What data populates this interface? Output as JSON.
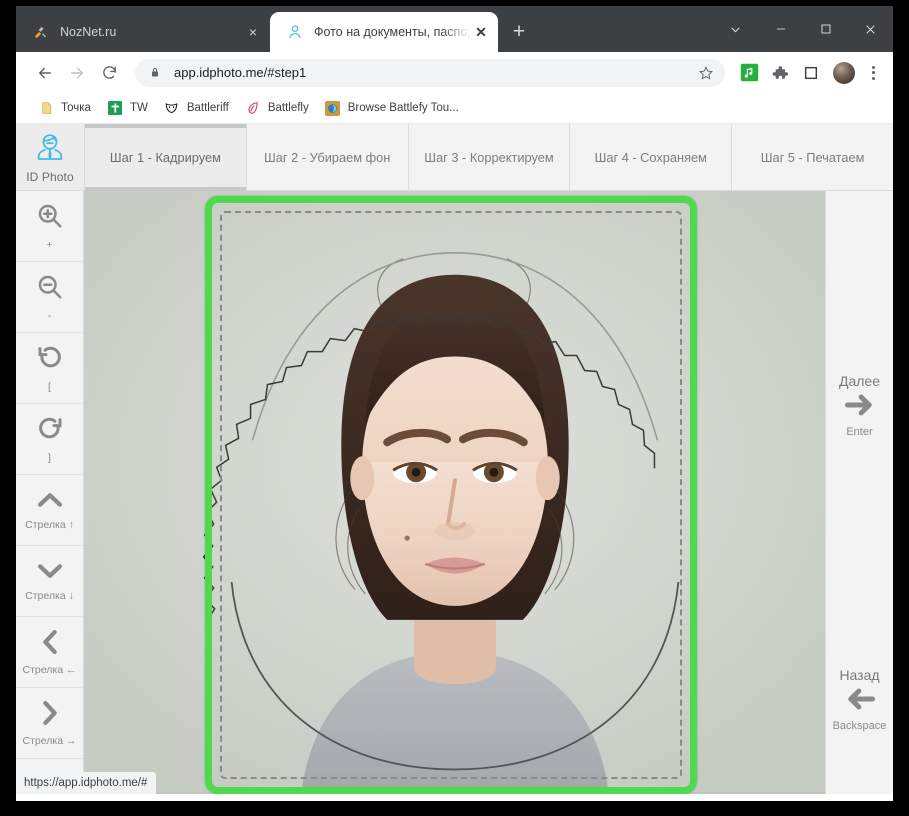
{
  "browser": {
    "tabs": [
      {
        "title": "NozNet.ru",
        "favicon": "tools-icon",
        "active": false,
        "close_label": "×"
      },
      {
        "title": "Фото на документы, паспорта, в",
        "favicon": "id-photo-icon",
        "active": true,
        "close_label": "✕"
      }
    ],
    "new_tab_label": "+",
    "window_controls": {
      "tab_search": "⌄",
      "minimize": "—",
      "maximize": "□",
      "close": "✕"
    },
    "toolbar": {
      "back": "←",
      "forward": "→",
      "reload": "⟳",
      "url": "app.idphoto.me/#step1",
      "lock": "lock-icon",
      "star": "☆",
      "extension_music": "♫",
      "extension_puzzle": "puzzle-icon",
      "extension_panel": "□",
      "profile": "avatar",
      "menu": "⋮"
    },
    "bookmarks": [
      {
        "label": "Точка",
        "icon": "note-icon"
      },
      {
        "label": "TW",
        "icon": "tw-icon"
      },
      {
        "label": "Battleriff",
        "icon": "battleriff-icon"
      },
      {
        "label": "Battlefly",
        "icon": "battlefly-icon"
      },
      {
        "label": "Browse Battlefy Tou...",
        "icon": "battlefy-icon"
      }
    ],
    "status_url": "https://app.idphoto.me/#"
  },
  "app": {
    "brand": {
      "label": "ID Photo",
      "icon": "id-photo-avatar-icon"
    },
    "steps": [
      {
        "label": "Шаг 1 - Кадрируем",
        "active": true
      },
      {
        "label": "Шаг 2 - Убираем фон",
        "active": false
      },
      {
        "label": "Шаг 3 - Корректируем",
        "active": false
      },
      {
        "label": "Шаг 4 - Сохраняем",
        "active": false
      },
      {
        "label": "Шаг 5 - Печатаем",
        "active": false
      }
    ],
    "left_tools": [
      {
        "icon": "zoom-in-icon",
        "label": "+"
      },
      {
        "icon": "zoom-out-icon",
        "label": "-"
      },
      {
        "icon": "rotate-left-icon",
        "label": "["
      },
      {
        "icon": "rotate-right-icon",
        "label": "]"
      },
      {
        "icon": "chevron-up-icon",
        "label": "Стрелка ↑"
      },
      {
        "icon": "chevron-down-icon",
        "label": "Стрелка ↓"
      },
      {
        "icon": "chevron-left-icon",
        "label": "Стрелка ←"
      },
      {
        "icon": "chevron-right-icon",
        "label": "Стрелка →"
      }
    ],
    "next_button": {
      "title": "Далее",
      "key": "Enter",
      "icon": "arrow-right-icon"
    },
    "back_button": {
      "title": "Назад",
      "key": "Backspace",
      "icon": "arrow-left-icon"
    },
    "colors": {
      "crop_border": "#4ddb4d",
      "brand_accent": "#3fbbe8",
      "guide": "#8a8a8a"
    }
  }
}
